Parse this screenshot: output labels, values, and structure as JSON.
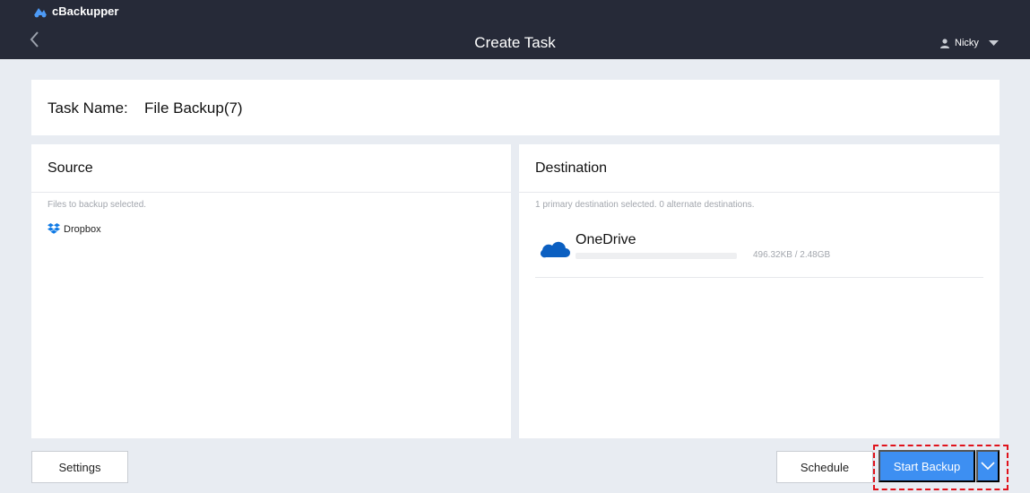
{
  "app": {
    "name": "cBackupper"
  },
  "header": {
    "title": "Create Task",
    "user": "Nicky"
  },
  "task": {
    "label": "Task Name:",
    "value": "File Backup(7)"
  },
  "source": {
    "title": "Source",
    "hint": "Files to backup selected.",
    "items": [
      {
        "name": "Dropbox",
        "icon": "dropbox-icon"
      }
    ]
  },
  "destination": {
    "title": "Destination",
    "hint": "1 primary destination selected.  0  alternate destinations.",
    "items": [
      {
        "name": "OneDrive",
        "icon": "onedrive-cloud-icon",
        "usage": "496.32KB / 2.48GB",
        "usage_fraction": 0.0002
      }
    ]
  },
  "footer": {
    "settings": "Settings",
    "schedule": "Schedule",
    "start": "Start Backup"
  },
  "colors": {
    "topbar": "#262a38",
    "accent": "#3d8ff2",
    "highlight": "#e0121b",
    "onedrive": "#0b5fc1",
    "dropbox": "#0f7ae5"
  }
}
